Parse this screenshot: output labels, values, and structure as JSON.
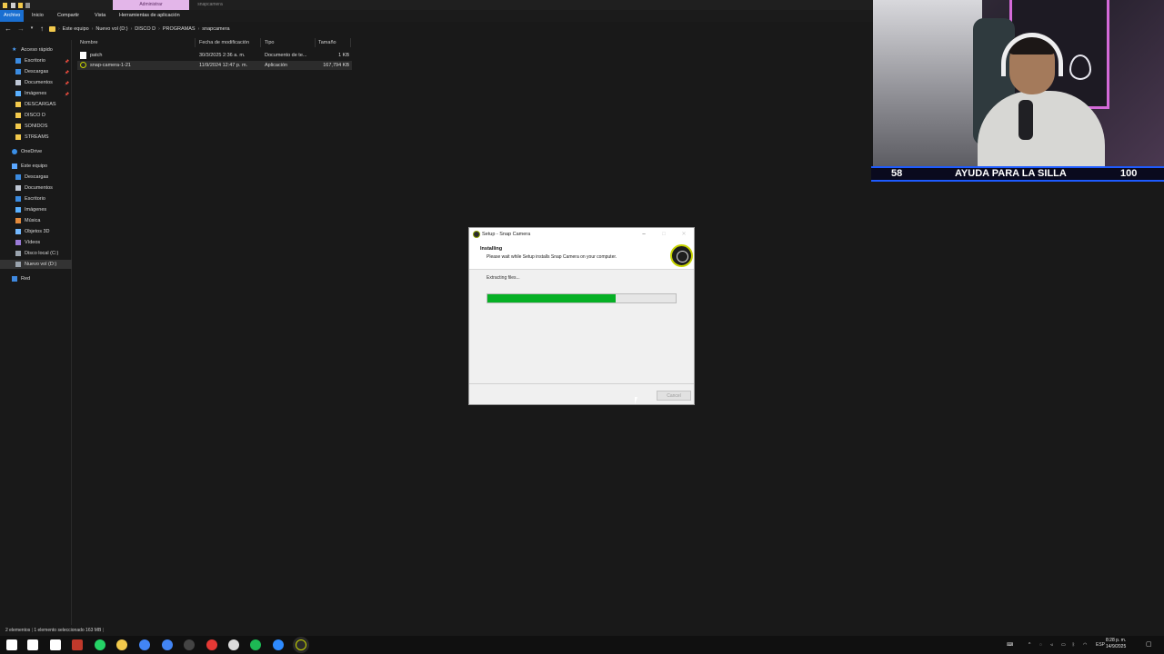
{
  "ribbon": {
    "context_tabs": {
      "admin": "Administrar",
      "folder": "snapcamera"
    },
    "tabs": [
      "Archivo",
      "Inicio",
      "Compartir",
      "Vista",
      "Herramientas de aplicación"
    ]
  },
  "address": {
    "crumbs": [
      "Este equipo",
      "Nuevo vol (D:)",
      "DISCO D",
      "PROGRAMAS",
      "snapcamera"
    ]
  },
  "nav": {
    "quick_access": "Acceso rápido",
    "items": [
      {
        "label": "Escritorio",
        "icon": "desktop-icon",
        "pinned": true
      },
      {
        "label": "Descargas",
        "icon": "download-icon",
        "pinned": true
      },
      {
        "label": "Documentos",
        "icon": "documents-icon",
        "pinned": true
      },
      {
        "label": "Imágenes",
        "icon": "pictures-icon",
        "pinned": true
      },
      {
        "label": "DESCARGAS",
        "icon": "folder-icon"
      },
      {
        "label": "DISCO D",
        "icon": "folder-icon"
      },
      {
        "label": "SONIDOS",
        "icon": "folder-icon"
      },
      {
        "label": "STREAMS",
        "icon": "folder-icon"
      }
    ],
    "onedrive": "OneDrive",
    "this_pc": "Este equipo",
    "pc_items": [
      {
        "label": "Descargas",
        "icon": "download-icon"
      },
      {
        "label": "Documentos",
        "icon": "documents-icon"
      },
      {
        "label": "Escritorio",
        "icon": "desktop-icon"
      },
      {
        "label": "Imágenes",
        "icon": "pictures-icon"
      },
      {
        "label": "Música",
        "icon": "music-icon"
      },
      {
        "label": "Objetos 3D",
        "icon": "3d-objects-icon"
      },
      {
        "label": "Vídeos",
        "icon": "videos-icon"
      },
      {
        "label": "Disco local (C:)",
        "icon": "drive-icon"
      },
      {
        "label": "Nuevo vol (D:)",
        "icon": "drive-icon"
      }
    ],
    "network": "Red"
  },
  "columns": {
    "name": "Nombre",
    "modified": "Fecha de modificación",
    "type": "Tipo",
    "size": "Tamaño"
  },
  "files": [
    {
      "name": "patch",
      "modified": "30/3/2025 2:36 a. m.",
      "type": "Documento de te...",
      "size": "1 KB"
    },
    {
      "name": "snap-camera-1-21",
      "modified": "11/9/2024 12:47 p. m.",
      "type": "Aplicación",
      "size": "167,794 KB"
    }
  ],
  "status": {
    "count": "2 elementos",
    "selected": "1 elemento seleccionado 163 MB"
  },
  "goal": {
    "current": "58",
    "label": "AYUDA PARA LA SILLA",
    "target": "100"
  },
  "dialog": {
    "title": "Setup - Snap Camera",
    "heading": "Installing",
    "subheading": "Please wait while Setup installs Snap Camera on your computer.",
    "status": "Extracting files...",
    "progress": 0.68,
    "cancel": "Cancel"
  },
  "taskbar": {
    "icons": [
      "windows-start-icon",
      "search-icon",
      "task-view-icon",
      "app-icon",
      "whatsapp-icon",
      "file-explorer-icon",
      "chrome-icon",
      "chrome-icon",
      "obs-icon",
      "record-icon",
      "app-icon",
      "spotify-icon",
      "app-icon",
      "snap-camera-icon"
    ],
    "lang": "ESP",
    "time": "8:28 p. m.",
    "date": "14/9/2025"
  },
  "colors": {
    "accent": "#1a6fd1",
    "progress": "#06b025",
    "context_tab": "#e3b6e9"
  }
}
